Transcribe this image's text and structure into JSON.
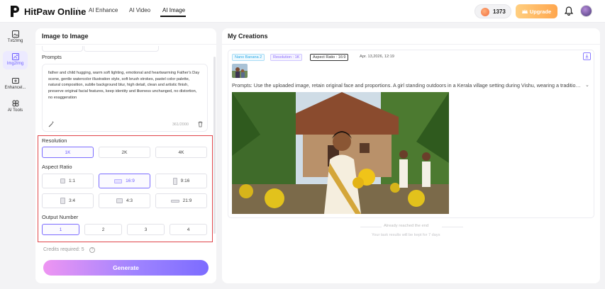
{
  "header": {
    "brand": "HitPaw Online",
    "nav": [
      {
        "label": "AI Enhance"
      },
      {
        "label": "AI Video"
      },
      {
        "label": "AI Image"
      }
    ],
    "credits": "1373",
    "upgrade_label": "Upgrade"
  },
  "rail": [
    {
      "label": "Txt2Img",
      "icon": "text-to-image-icon"
    },
    {
      "label": "Img2Img",
      "icon": "image-to-image-icon"
    },
    {
      "label": "Enhancel...",
      "icon": "enhance-icon"
    },
    {
      "label": "AI Tools",
      "icon": "tools-icon"
    }
  ],
  "left": {
    "title": "Image to Image",
    "prompts_label": "Prompts",
    "prompt_text": "father and child hugging, warm soft lighting, emotional and heartwarming Father's Day scene, gentle watercolor illustration style, soft brush strokes, pastel color palette, natural composition, subtle background blur, high detail, clean and artistic finish, preserve original facial features, keep identity and likeness unchanged, no distortion, no exaggeration",
    "prompt_count": "361/2000",
    "resolution_label": "Resolution",
    "resolutions": [
      "1K",
      "2K",
      "4K"
    ],
    "aspect_label": "Aspect Ratio",
    "aspects": [
      "1:1",
      "16:9",
      "9:16",
      "3:4",
      "4:3",
      "21:9"
    ],
    "output_label": "Output Number",
    "outputs": [
      "1",
      "2",
      "3",
      "4"
    ],
    "cost": "Credits required: 5",
    "generate_label": "Generate"
  },
  "right": {
    "title": "My Creations",
    "tag_model": "Nano Banana 2",
    "tag_resolution": "Resolution : 1K",
    "tag_aspect": "Aspect Ratio : 16:9",
    "date": "Apr. 13,2026, 12:19",
    "prompt": "Prompts: Use the uploaded image, retain original face and proportions. A girl standing outdoors in a Kerala village setting during Vishu, wearing a traditional Kerala saree...",
    "end_text": "Already reached the end",
    "keep_text": "Your task results will be kept for 7 days"
  },
  "colors": {
    "accent": "#6b5cff",
    "highlight_border": "#e0454a",
    "upgrade": "#ffa64d"
  }
}
